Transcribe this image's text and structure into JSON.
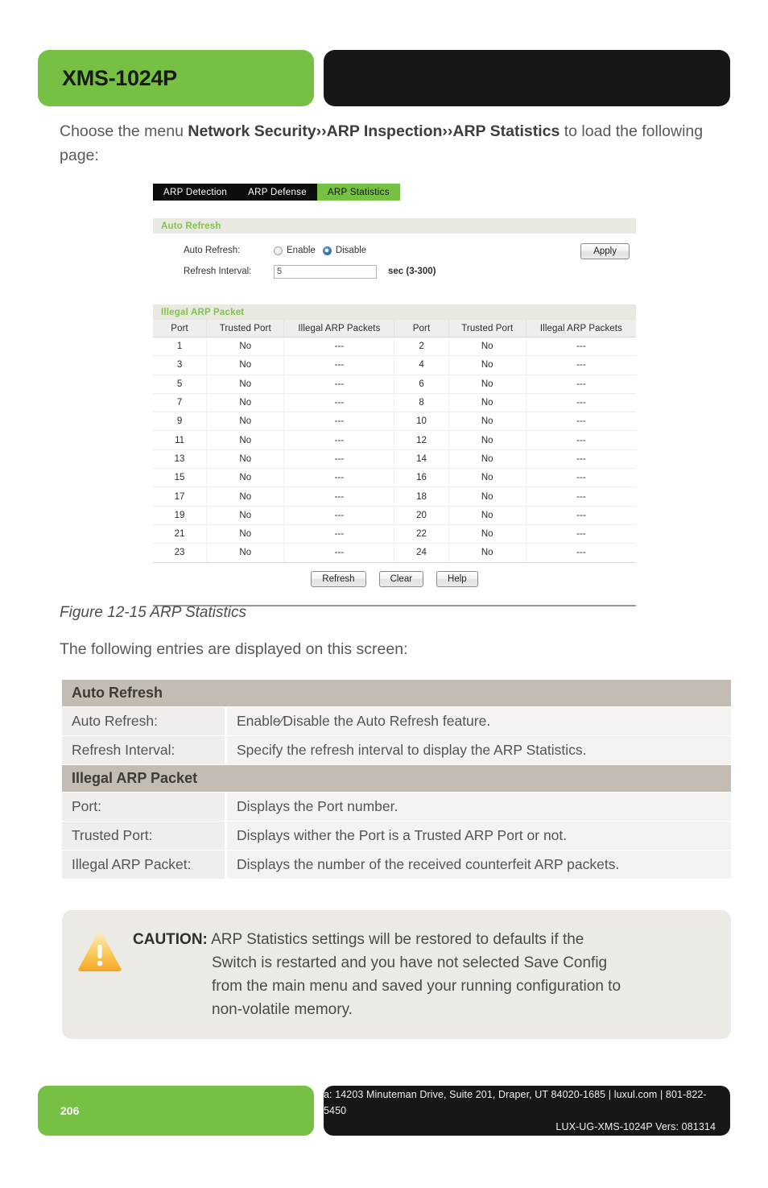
{
  "header": {
    "product_title": "XMS-1024P"
  },
  "intro": {
    "before": "Choose the menu ",
    "menu_path": "Network Security››ARP Inspection››ARP Statistics",
    "after": " to load the following page:"
  },
  "ui": {
    "tabs": [
      {
        "label": "ARP Detection",
        "active": false
      },
      {
        "label": "ARP Defense",
        "active": false
      },
      {
        "label": "ARP Statistics",
        "active": true
      }
    ],
    "auto_refresh_panel": {
      "title": "Auto Refresh",
      "auto_refresh_label": "Auto Refresh:",
      "enable_label": "Enable",
      "disable_label": "Disable",
      "selected": "Disable",
      "refresh_interval_label": "Refresh Interval:",
      "refresh_interval_value": "5",
      "refresh_interval_unit": "sec (3-300)",
      "apply_label": "Apply"
    },
    "illegal_panel": {
      "title": "Illegal ARP Packet",
      "headers": [
        "Port",
        "Trusted Port",
        "Illegal ARP Packets",
        "Port",
        "Trusted Port",
        "Illegal ARP Packets"
      ],
      "rows": [
        [
          "1",
          "No",
          "---",
          "2",
          "No",
          "---"
        ],
        [
          "3",
          "No",
          "---",
          "4",
          "No",
          "---"
        ],
        [
          "5",
          "No",
          "---",
          "6",
          "No",
          "---"
        ],
        [
          "7",
          "No",
          "---",
          "8",
          "No",
          "---"
        ],
        [
          "9",
          "No",
          "---",
          "10",
          "No",
          "---"
        ],
        [
          "11",
          "No",
          "---",
          "12",
          "No",
          "---"
        ],
        [
          "13",
          "No",
          "---",
          "14",
          "No",
          "---"
        ],
        [
          "15",
          "No",
          "---",
          "16",
          "No",
          "---"
        ],
        [
          "17",
          "No",
          "---",
          "18",
          "No",
          "---"
        ],
        [
          "19",
          "No",
          "---",
          "20",
          "No",
          "---"
        ],
        [
          "21",
          "No",
          "---",
          "22",
          "No",
          "---"
        ],
        [
          "23",
          "No",
          "---",
          "24",
          "No",
          "---"
        ]
      ],
      "buttons": [
        "Refresh",
        "Clear",
        "Help"
      ]
    }
  },
  "figure": {
    "caption": "Figure 12-15 ARP Statistics",
    "lead_in": "The following entries are displayed on this screen:"
  },
  "description_table": {
    "sections": [
      {
        "title": "Auto Refresh",
        "entries": [
          {
            "key": "Auto Refresh:",
            "value": "Enable∕Disable the Auto Refresh feature."
          },
          {
            "key": "Refresh Interval:",
            "value": "Specify the refresh interval to display the ARP Statistics."
          }
        ]
      },
      {
        "title": "Illegal ARP Packet",
        "entries": [
          {
            "key": "Port:",
            "value": "Displays the Port number."
          },
          {
            "key": "Trusted Port:",
            "value": "Displays wither the Port is a Trusted ARP Port or not."
          },
          {
            "key": "Illegal ARP Packet:",
            "value": "Displays the number of the received counterfeit ARP packets."
          }
        ]
      }
    ]
  },
  "caution": {
    "label": "CAUTION:",
    "line1": " ARP Statistics settings will be restored to defaults if the",
    "line2": "Switch is restarted and you have not selected Save Config",
    "line3": "from the main menu and saved your running configuration to",
    "line4": "non-volatile memory."
  },
  "footer": {
    "page_number": "206",
    "address_line": "a: 14203 Minuteman Drive, Suite 201, Draper, UT 84020-1685 | luxul.com | 801-822-5450",
    "doc_line": "LUX-UG-XMS-1024P  Vers: 081314"
  },
  "colors": {
    "brand_green": "#76c043",
    "brand_black": "#17171a",
    "section_header_grey": "#c2bcb3",
    "caution_bg": "#edeae5"
  }
}
